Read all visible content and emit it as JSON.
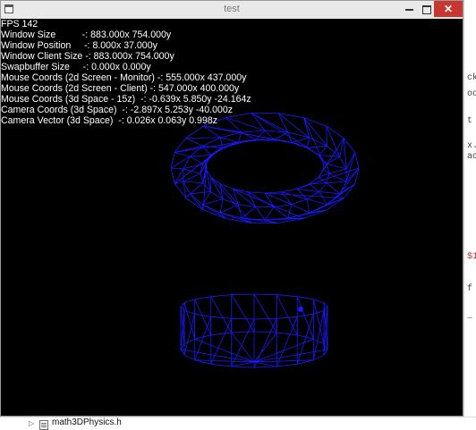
{
  "window": {
    "title": "test",
    "icons": {
      "app": "app-window-icon",
      "minimize": "minimize-icon",
      "maximize": "maximize-icon",
      "close": "close-icon"
    },
    "close_glyph": "✕"
  },
  "hud": {
    "lines": [
      "FPS 142",
      "Window Size          -: 883.000x 754.000y",
      "Window Position     -: 8.000x 37.000y",
      "Window Client Size -: 883.000x 754.000y",
      "Swapbuffer Size     -: 0.000x 0.000y",
      "Mouse Coords (2d Screen - Monitor) -: 555.000x 437.000y",
      "Mouse Coords (2d Screen - Client) -: 547.000x 400.000y",
      "Mouse Coords (3d Space - 15z)  -: -0.639x 5.850y -24.164z",
      "Camera Coords (3d Space)  -: -2.897x 5.253y -40.000z",
      "Camera Vector (3d Space)  -: 0.026x 0.063y 0.998z"
    ]
  },
  "scene": {
    "wire_color": "#1a1aff",
    "background": "#000000"
  },
  "ide": {
    "tree_file": "math3DPhysics.h",
    "fragments": [
      "ck",
      "oo",
      "t",
      "x.",
      "ac",
      "$1",
      "f",
      "_"
    ]
  }
}
